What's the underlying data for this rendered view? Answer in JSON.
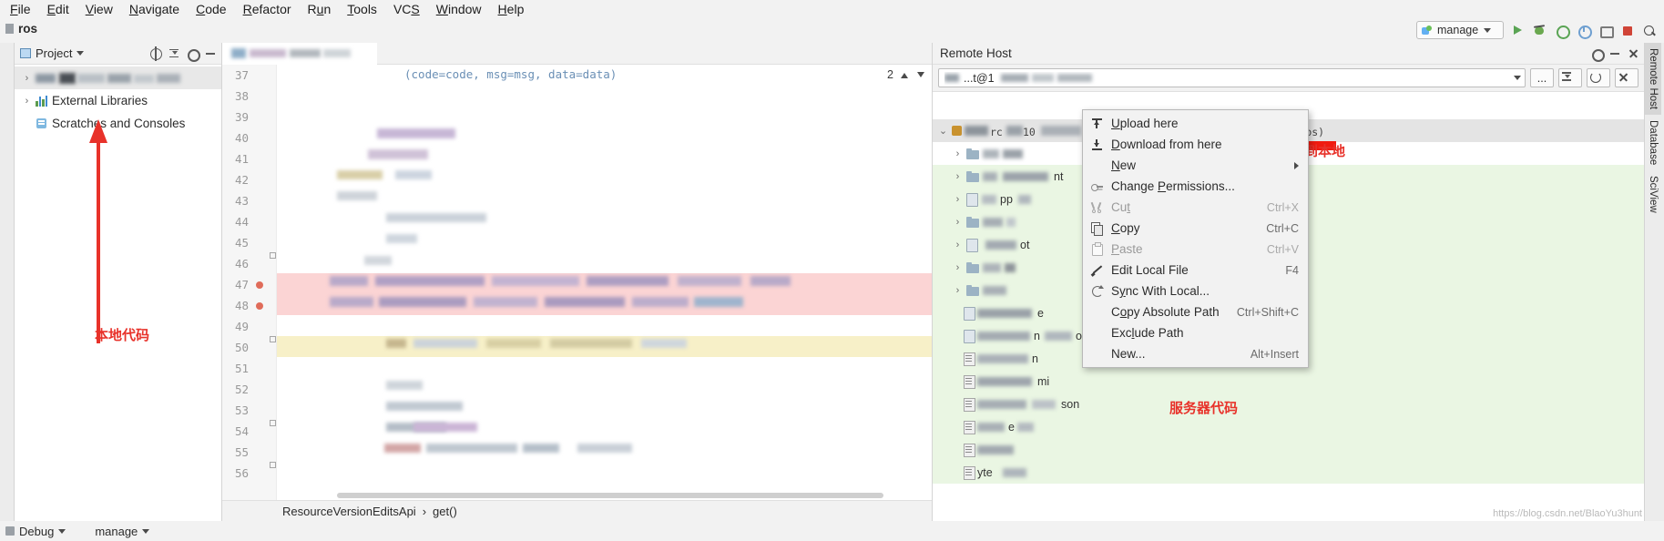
{
  "menubar": {
    "items": [
      {
        "label": "File",
        "mnemonic": "F"
      },
      {
        "label": "Edit",
        "mnemonic": "E"
      },
      {
        "label": "View",
        "mnemonic": "V"
      },
      {
        "label": "Navigate",
        "mnemonic": "N"
      },
      {
        "label": "Code",
        "mnemonic": "C"
      },
      {
        "label": "Refactor",
        "mnemonic": "R"
      },
      {
        "label": "Run",
        "mnemonic": "u"
      },
      {
        "label": "Tools",
        "mnemonic": "T"
      },
      {
        "label": "VCS",
        "mnemonic": "S"
      },
      {
        "label": "Window",
        "mnemonic": "W"
      },
      {
        "label": "Help",
        "mnemonic": "H"
      }
    ]
  },
  "titlebar": {
    "project_name": "ros"
  },
  "toolbar": {
    "run_config": "manage",
    "icons": [
      "run-icon",
      "debug-icon",
      "coverage-icon",
      "profile-icon",
      "attach-icon",
      "stop-icon",
      "search-everywhere-icon"
    ]
  },
  "project_panel": {
    "title": "Project",
    "header_icons": [
      "locate-icon",
      "collapse-all-icon",
      "settings-gear-icon",
      "hide-icon"
    ],
    "tree": [
      {
        "label": "",
        "redacted": true,
        "selected": true,
        "indent": 0,
        "chevron": "›",
        "icon": "folder-icon"
      },
      {
        "label": "External Libraries",
        "redacted": false,
        "selected": false,
        "indent": 0,
        "chevron": "›",
        "icon": "library-icon"
      },
      {
        "label": "Scratches and Consoles",
        "redacted": false,
        "selected": false,
        "indent": 1,
        "chevron": "",
        "icon": "scratch-icon"
      }
    ]
  },
  "editor": {
    "tab_label": "",
    "inspector_count": "2",
    "breadcrumb": [
      "ResourceVersionEditsApi",
      "get()"
    ],
    "breadcrumb_sep": "›",
    "line_numbers": [
      "37",
      "38",
      "39",
      "40",
      "41",
      "42",
      "43",
      "44",
      "45",
      "46",
      "47",
      "48",
      "49",
      "50",
      "51",
      "52",
      "53",
      "54",
      "55",
      "56"
    ],
    "visible_code_fragments": [
      "(code=code, msg=msg, data=data)"
    ]
  },
  "remote_panel": {
    "title": "Remote Host",
    "header_icons": [
      "settings-gear-icon",
      "hide-icon",
      "close-icon"
    ],
    "host_combo_value": "...t@1",
    "toolbar_buttons": [
      "browse-button",
      "collapse-all-button",
      "refresh-button",
      "close-button"
    ],
    "browse_label": "...",
    "tree": [
      {
        "label": "",
        "redacted": true,
        "level": 0,
        "chevron": "⌄",
        "icon": "server-icon",
        "bg": "root"
      },
      {
        "label": "",
        "redacted": true,
        "level": 1,
        "chevron": "›",
        "icon": "folder-icon",
        "bg": "white"
      },
      {
        "label": "",
        "redacted": true,
        "level": 1,
        "chevron": "›",
        "icon": "folder-icon",
        "bg": "green"
      },
      {
        "label": "",
        "redacted": true,
        "level": 1,
        "chevron": "›",
        "icon": "folder-icon",
        "bg": "green"
      },
      {
        "label": "",
        "redacted": true,
        "level": 1,
        "chevron": "›",
        "icon": "folder-icon",
        "bg": "green"
      },
      {
        "label": "",
        "redacted": true,
        "level": 1,
        "chevron": "›",
        "icon": "folder-icon",
        "bg": "green"
      },
      {
        "label": "",
        "redacted": true,
        "level": 1,
        "chevron": "›",
        "icon": "folder-icon",
        "bg": "green"
      },
      {
        "label": "",
        "redacted": true,
        "level": 1,
        "chevron": "›",
        "icon": "folder-icon",
        "bg": "green"
      },
      {
        "label": "",
        "redacted": true,
        "level": 2,
        "chevron": "",
        "icon": "file-icon",
        "bg": "green"
      },
      {
        "label": "",
        "redacted": true,
        "level": 2,
        "chevron": "",
        "icon": "file-icon",
        "bg": "green"
      },
      {
        "label": "",
        "redacted": true,
        "level": 2,
        "chevron": "",
        "icon": "text-file-icon",
        "bg": "green"
      },
      {
        "label": "",
        "redacted": true,
        "level": 2,
        "chevron": "",
        "icon": "text-file-icon",
        "bg": "green"
      },
      {
        "label": "",
        "redacted": true,
        "level": 2,
        "chevron": "",
        "icon": "text-file-icon",
        "bg": "green"
      },
      {
        "label": "",
        "redacted": true,
        "level": 2,
        "chevron": "",
        "icon": "text-file-icon",
        "bg": "green"
      },
      {
        "label": "",
        "redacted": true,
        "level": 2,
        "chevron": "",
        "icon": "text-file-icon",
        "bg": "green"
      },
      {
        "label": "",
        "redacted": true,
        "level": 2,
        "chevron": "",
        "icon": "text-file-icon",
        "bg": "green"
      }
    ]
  },
  "context_menu": {
    "items": [
      {
        "label": "Upload here",
        "mnemonic": "U",
        "icon": "upload-icon",
        "shortcut": "",
        "disabled": false,
        "submenu": false
      },
      {
        "label": "Download from here",
        "mnemonic": "D",
        "icon": "download-icon",
        "shortcut": "",
        "disabled": false,
        "submenu": false,
        "highlighted": true
      },
      {
        "label": "New",
        "mnemonic": "N",
        "icon": "",
        "shortcut": "",
        "disabled": false,
        "submenu": true
      },
      {
        "label": "Change Permissions...",
        "mnemonic": "P",
        "icon": "key-icon",
        "shortcut": "",
        "disabled": false,
        "submenu": false
      },
      {
        "label": "Cut",
        "mnemonic": "t",
        "icon": "cut-icon",
        "shortcut": "Ctrl+X",
        "disabled": true,
        "submenu": false
      },
      {
        "label": "Copy",
        "mnemonic": "C",
        "icon": "copy-icon",
        "shortcut": "Ctrl+C",
        "disabled": false,
        "submenu": false
      },
      {
        "label": "Paste",
        "mnemonic": "P",
        "icon": "paste-icon",
        "shortcut": "Ctrl+V",
        "disabled": true,
        "submenu": false
      },
      {
        "label": "Edit Local File",
        "mnemonic": "",
        "icon": "pencil-icon",
        "shortcut": "F4",
        "disabled": false,
        "submenu": false
      },
      {
        "label": "Sync With Local...",
        "mnemonic": "y",
        "icon": "sync-icon",
        "shortcut": "",
        "disabled": false,
        "submenu": false
      },
      {
        "label": "Copy Absolute Path",
        "mnemonic": "o",
        "icon": "",
        "shortcut": "Ctrl+Shift+C",
        "disabled": false,
        "submenu": false
      },
      {
        "label": "Exclude Path",
        "mnemonic": "l",
        "icon": "",
        "shortcut": "",
        "disabled": false,
        "submenu": false
      },
      {
        "label": "New...",
        "mnemonic": "",
        "icon": "",
        "shortcut": "Alt+Insert",
        "disabled": false,
        "submenu": false
      }
    ]
  },
  "annotations": [
    {
      "id": "local-code",
      "text": "本地代码",
      "color": "#e8322a"
    },
    {
      "id": "download-to-local",
      "text": "下载到本地",
      "color": "#e8322a"
    },
    {
      "id": "server-code",
      "text": "服务器代码",
      "color": "#e8322a"
    }
  ],
  "right_strip": {
    "tabs": [
      "Remote Host",
      "Database",
      "SciView"
    ]
  },
  "statusbar": {
    "items": [
      "Debug",
      "manage"
    ]
  },
  "watermark": "https://blog.csdn.net/BlaoYu3hunt",
  "colors": {
    "accent_red": "#f01b10",
    "green_tree_bg": "#eaf6e3",
    "selection_gray": "#e4e4e4",
    "panel_bg": "#f2f2f2"
  }
}
